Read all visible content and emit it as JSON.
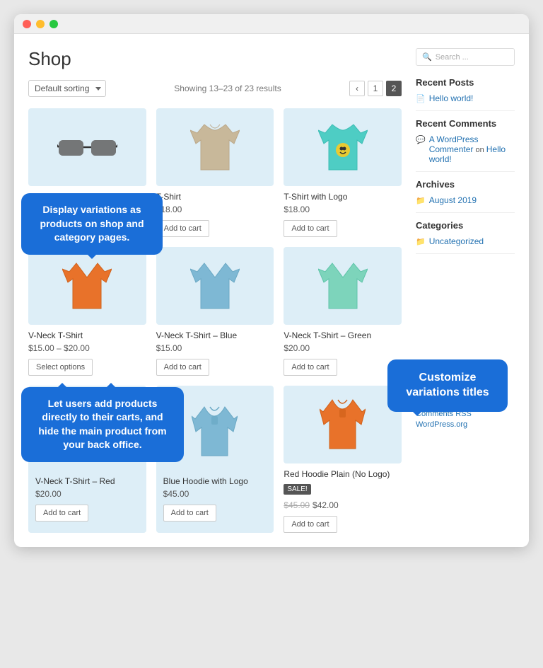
{
  "window": {
    "dots": [
      "red",
      "yellow",
      "green"
    ]
  },
  "header": {
    "title": "Shop"
  },
  "toolbar": {
    "sort_label": "Default sorting",
    "results_text": "Showing 13–23 of 23 results",
    "page_current": "1",
    "page_next": "2",
    "prev_arrow": "‹"
  },
  "products": [
    {
      "name": "Sunglasses",
      "price": "",
      "type": "glasses",
      "buttons": []
    },
    {
      "name": "T-Shirt",
      "price": "$18.00",
      "type": "tshirt_plain",
      "color": "beige",
      "buttons": [
        "Add to cart"
      ]
    },
    {
      "name": "T-Shirt with Logo",
      "price": "$18.00",
      "type": "tshirt_logo",
      "color": "mint",
      "buttons": [
        "Add to cart"
      ]
    },
    {
      "name": "V-Neck T-Shirt",
      "price": "$15.00 – $20.00",
      "type": "tshirt_vneck",
      "color": "orange",
      "buttons": [
        "Select options"
      ]
    },
    {
      "name": "V-Neck T-Shirt – Blue",
      "price": "$15.00",
      "type": "tshirt_vneck",
      "color": "blue",
      "buttons": [
        "Add to cart"
      ]
    },
    {
      "name": "V-Neck T-Shirt – Green",
      "price": "$20.00",
      "type": "tshirt_vneck",
      "color": "mint",
      "buttons": [
        "Add to cart"
      ]
    },
    {
      "name": "V-Neck T-Shirt – Red",
      "price": "$20.00",
      "type": "tshirt_vneck",
      "color": "red",
      "buttons": [
        "Add to cart"
      ]
    },
    {
      "name": "Blue Hoodie with Logo",
      "price": "$45.00",
      "type": "hoodie",
      "color": "blue",
      "buttons": [
        "Add to cart"
      ]
    },
    {
      "name": "Red Hoodie Plain (No Logo)",
      "price": "$42.00",
      "original_price": "$45.00",
      "sale": true,
      "type": "hoodie",
      "color": "orange",
      "buttons": [
        "Add to cart"
      ]
    }
  ],
  "tooltips": {
    "bubble1": "Display variations as products on shop and category pages.",
    "bubble2": "Let users add products directly to their carts, and hide the main product from your back office.",
    "sidebar": "Customize variations titles"
  },
  "sidebar": {
    "search_placeholder": "Search ...",
    "recent_posts_title": "Recent Posts",
    "recent_posts": [
      {
        "text": "Hello world!"
      }
    ],
    "recent_comments_title": "Recent Comments",
    "recent_comments": [
      {
        "author": "A WordPress Commenter",
        "text": " on ",
        "link": "Hello world!"
      }
    ],
    "archives_title": "Archives",
    "archives": [
      {
        "text": "August 2019"
      }
    ],
    "categories_title": "Categories",
    "categories": [
      {
        "text": "Uncategorized"
      }
    ],
    "meta_links": [
      "Comments RSS",
      "WordPress.org"
    ]
  }
}
